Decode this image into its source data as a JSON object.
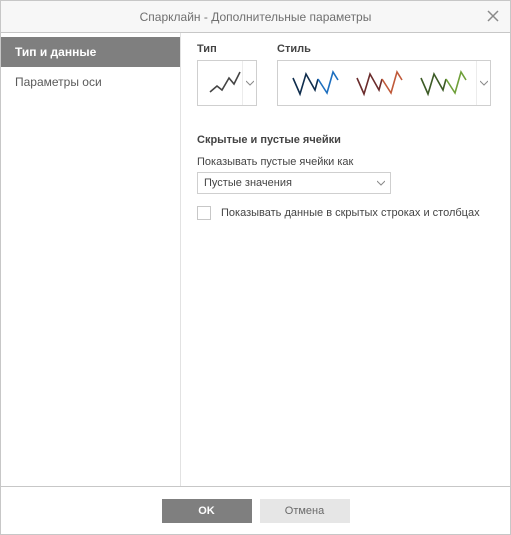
{
  "dialog": {
    "title": "Спарклайн - Дополнительные параметры"
  },
  "sidebar": {
    "items": [
      {
        "label": "Тип и данные",
        "active": true
      },
      {
        "label": "Параметры оси",
        "active": false
      }
    ]
  },
  "content": {
    "type_label": "Тип",
    "style_label": "Стиль",
    "type_icon": "line-sparkline",
    "style_swatches": [
      {
        "colors": [
          "#0f2d4d",
          "#1e6fbf"
        ]
      },
      {
        "colors": [
          "#6b2c2c",
          "#c05a3a"
        ]
      },
      {
        "colors": [
          "#3d5b26",
          "#6fa03a"
        ]
      }
    ],
    "section_header": "Скрытые и пустые ячейки",
    "empty_label": "Показывать пустые ячейки как",
    "empty_value": "Пустые значения",
    "show_hidden_label": "Показывать данные в скрытых строках и столбцах",
    "show_hidden_checked": false
  },
  "footer": {
    "ok": "OK",
    "cancel": "Отмена"
  },
  "colors": {
    "accent": "#7f7f7f"
  }
}
